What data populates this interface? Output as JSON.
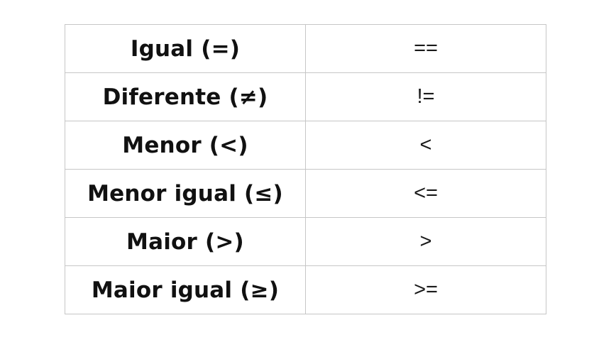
{
  "table": {
    "rows": [
      {
        "name": "Igual (=)",
        "symbol": "=="
      },
      {
        "name": "Diferente (≠)",
        "symbol": "!="
      },
      {
        "name": "Menor (<)",
        "symbol": "<"
      },
      {
        "name": "Menor igual (≤)",
        "symbol": "<="
      },
      {
        "name": "Maior (>)",
        "symbol": ">"
      },
      {
        "name": "Maior igual (≥)",
        "symbol": ">="
      }
    ]
  }
}
